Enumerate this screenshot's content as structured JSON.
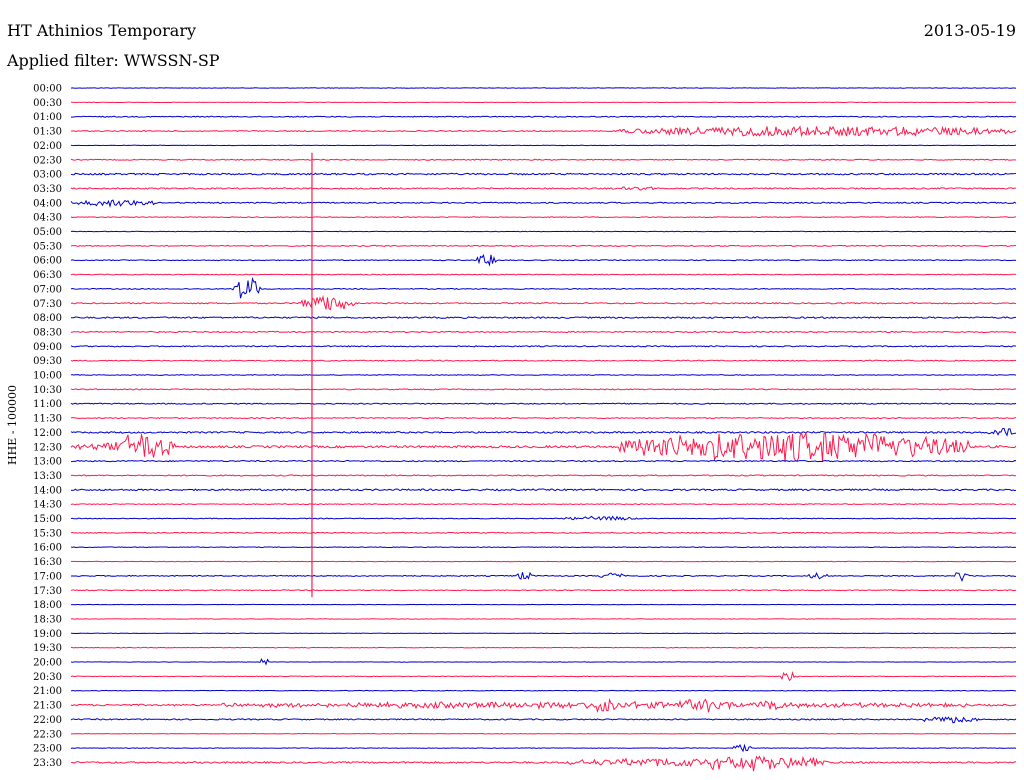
{
  "header": {
    "station": "HT Athinios Temporary",
    "date": "2013-05-19",
    "filter": "Applied filter: WWSSN-SP"
  },
  "colors": {
    "blue": "#0000cc",
    "red": "#ff1a4d"
  },
  "chart_data": {
    "type": "line",
    "title": "HT Athinios Temporary",
    "subtitle": "Applied filter: WWSSN-SP",
    "ylabel": "HHE - 100000",
    "xlabel": "",
    "grid": false,
    "row_labels": [
      "00:00",
      "00:30",
      "01:00",
      "01:30",
      "02:00",
      "02:30",
      "03:00",
      "03:30",
      "04:00",
      "04:30",
      "05:00",
      "05:30",
      "06:00",
      "06:30",
      "07:00",
      "07:30",
      "08:00",
      "08:30",
      "09:00",
      "09:30",
      "10:00",
      "10:30",
      "11:00",
      "11:30",
      "12:00",
      "12:30",
      "13:00",
      "13:30",
      "14:00",
      "14:30",
      "15:00",
      "15:30",
      "16:00",
      "16:30",
      "17:00",
      "17:30",
      "18:00",
      "18:30",
      "19:00",
      "19:30",
      "20:00",
      "20:30",
      "21:00",
      "21:30",
      "22:00",
      "22:30",
      "23:00",
      "23:30"
    ],
    "series_colors": [
      "blue",
      "red"
    ],
    "x_range_minutes": [
      0,
      30
    ],
    "amplitude": {
      "baseline": [
        0.5,
        0.4,
        1,
        1,
        0.5,
        1,
        1.6,
        1.3,
        1.2,
        0.8,
        0.5,
        1,
        0.9,
        0.8,
        0.9,
        1.2,
        1.5,
        1.2,
        1.1,
        1,
        0.7,
        1,
        1.1,
        1,
        1.6,
        2.2,
        1.2,
        1.1,
        1.6,
        0.8,
        0.8,
        1,
        0.7,
        0.5,
        1,
        0.9,
        0.4,
        0.5,
        0.4,
        0.6,
        0.4,
        0.6,
        0.6,
        1.6,
        1.2,
        0.4,
        0.6,
        1.6
      ]
    },
    "events": [
      {
        "row": 3,
        "start": 0.58,
        "end": 1.0,
        "amp": 5
      },
      {
        "row": 7,
        "start": 0.578,
        "end": 0.62,
        "amp": 2
      },
      {
        "row": 8,
        "start": 0.0,
        "end": 0.09,
        "amp": 3
      },
      {
        "row": 12,
        "start": 0.43,
        "end": 0.45,
        "amp": 6
      },
      {
        "row": 14,
        "start": 0.17,
        "end": 0.2,
        "amp": 12
      },
      {
        "row": 15,
        "start": 0.24,
        "end": 0.3,
        "amp": 8
      },
      {
        "row": 24,
        "start": 0.97,
        "end": 1.0,
        "amp": 5
      },
      {
        "row": 25,
        "start": 0.0,
        "end": 0.1,
        "amp": 4
      },
      {
        "row": 25,
        "start": 0.05,
        "end": 0.11,
        "amp": 14
      },
      {
        "row": 25,
        "start": 0.578,
        "end": 0.95,
        "amp": 15
      },
      {
        "row": 30,
        "start": 0.52,
        "end": 0.6,
        "amp": 2
      },
      {
        "row": 34,
        "start": 0.47,
        "end": 0.49,
        "amp": 4
      },
      {
        "row": 34,
        "start": 0.56,
        "end": 0.59,
        "amp": 3
      },
      {
        "row": 34,
        "start": 0.78,
        "end": 0.8,
        "amp": 3
      },
      {
        "row": 34,
        "start": 0.935,
        "end": 0.95,
        "amp": 5
      },
      {
        "row": 40,
        "start": 0.2,
        "end": 0.21,
        "amp": 4
      },
      {
        "row": 41,
        "start": 0.75,
        "end": 0.77,
        "amp": 5
      },
      {
        "row": 43,
        "start": 0.16,
        "end": 0.95,
        "amp": 3
      },
      {
        "row": 43,
        "start": 0.55,
        "end": 0.58,
        "amp": 6
      },
      {
        "row": 43,
        "start": 0.65,
        "end": 0.68,
        "amp": 8
      },
      {
        "row": 43,
        "start": 0.73,
        "end": 0.75,
        "amp": 5
      },
      {
        "row": 44,
        "start": 0.9,
        "end": 0.96,
        "amp": 3
      },
      {
        "row": 46,
        "start": 0.7,
        "end": 0.72,
        "amp": 4
      },
      {
        "row": 47,
        "start": 0.52,
        "end": 0.8,
        "amp": 4
      },
      {
        "row": 47,
        "start": 0.66,
        "end": 0.8,
        "amp": 6
      }
    ],
    "spike": {
      "x_fraction": 0.255,
      "row_from": 5,
      "row_to": 35
    }
  }
}
